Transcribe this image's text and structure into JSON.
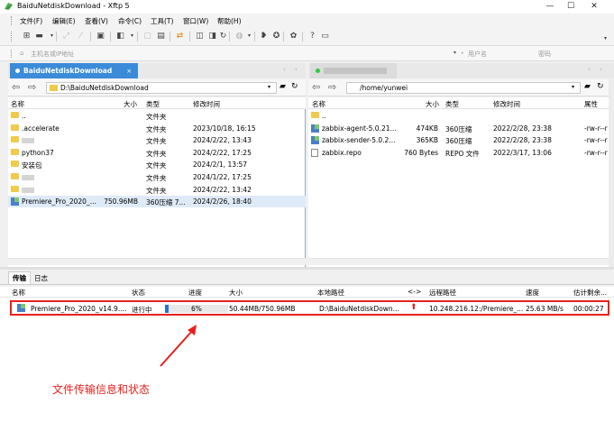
{
  "window": {
    "title": "BaiduNetdiskDownload - Xftp 5"
  },
  "menu": [
    "文件(F)",
    "编辑(E)",
    "查看(V)",
    "命令(C)",
    "工具(T)",
    "窗口(W)",
    "帮助(H)"
  ],
  "address_bar": {
    "placeholder": "主机名或IP地址",
    "username_placeholder": "用户名",
    "password_placeholder": "密码"
  },
  "left_panel": {
    "tab_label": "BaiduNetdiskDownload",
    "path": "D:\\BaiduNetdiskDownload",
    "columns": {
      "name": "名称",
      "size": "大小",
      "type": "类型",
      "modified": "修改时间"
    },
    "rows": [
      {
        "name": "..",
        "size": "",
        "type": "文件夹",
        "modified": "",
        "icon": "folder"
      },
      {
        "name": ".accelerate",
        "size": "",
        "type": "文件夹",
        "modified": "2023/10/18, 16:15",
        "icon": "folder"
      },
      {
        "name": "",
        "size": "",
        "type": "文件夹",
        "modified": "2024/2/22, 13:43",
        "icon": "folder"
      },
      {
        "name": "python37",
        "size": "",
        "type": "文件夹",
        "modified": "2024/2/22, 17:25",
        "icon": "folder"
      },
      {
        "name": "安装包",
        "size": "",
        "type": "文件夹",
        "modified": "2024/2/1, 13:57",
        "icon": "folder"
      },
      {
        "name": "",
        "size": "",
        "type": "文件夹",
        "modified": "2024/1/22, 17:25",
        "icon": "folder"
      },
      {
        "name": "",
        "size": "",
        "type": "文件夹",
        "modified": "2024/2/22, 13:42",
        "icon": "folder"
      },
      {
        "name": "Premiere_Pro_2020_...",
        "size": "750.96MB",
        "type": "360压缩 7...",
        "modified": "2024/2/26, 18:40",
        "icon": "archive"
      }
    ]
  },
  "right_panel": {
    "path": "/home/yunwei",
    "columns": {
      "name": "名称",
      "size": "大小",
      "type": "类型",
      "modified": "修改时间",
      "attr": "属性"
    },
    "rows": [
      {
        "name": "..",
        "size": "",
        "type": "",
        "modified": "",
        "attr": "",
        "icon": "folder"
      },
      {
        "name": "zabbix-agent-5.0.21...",
        "size": "474KB",
        "type": "360压缩",
        "modified": "2022/2/28, 23:38",
        "attr": "-rw-r--r",
        "icon": "rpm"
      },
      {
        "name": "zabbix-sender-5.0.2...",
        "size": "365KB",
        "type": "360压缩",
        "modified": "2022/2/28, 23:38",
        "attr": "-rw-r--r",
        "icon": "rpm"
      },
      {
        "name": "zabbix.repo",
        "size": "760 Bytes",
        "type": "REPO 文件",
        "modified": "2022/3/17, 13:06",
        "attr": "-rw-r--r",
        "icon": "file"
      }
    ]
  },
  "bottom": {
    "tabs": [
      "传输",
      "日志"
    ],
    "columns": {
      "name": "名称",
      "status": "状态",
      "progress": "进度",
      "size": "大小",
      "local_path": "本地路径",
      "direction": "<->",
      "remote_path": "远程路径",
      "speed": "速度",
      "eta": "估计剩余..."
    },
    "transfer": {
      "name": "Premiere_Pro_2020_v14.9....",
      "status": "进行中",
      "progress": 6,
      "progress_label": "6%",
      "size": "50.44MB/750.96MB",
      "local_path": "D:\\BaiduNetdiskDown...",
      "remote_path": "10.248.216.12:/Premiere_...",
      "speed": "25.63 MB/s",
      "eta": "00:00:27"
    }
  },
  "annotation": "文件传输信息和状态",
  "colors": {
    "accent": "#3b8bd9",
    "annotation": "#e8211c",
    "progress": "#2a72d0"
  }
}
